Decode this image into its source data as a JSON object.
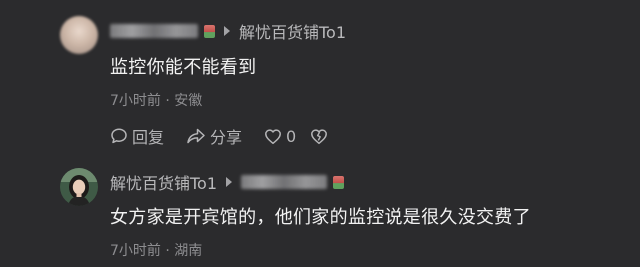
{
  "comments": [
    {
      "reply_to": "解忧百货铺To1",
      "text": "监控你能不能看到",
      "time": "7小时前",
      "location": "安徽",
      "actions": {
        "reply": "回复",
        "share": "分享",
        "likes": "0"
      }
    },
    {
      "author": "解忧百货铺To1",
      "text": "女方家是开宾馆的，他们家的监控说是很久没交费了",
      "time": "7小时前",
      "location": "湖南"
    }
  ],
  "separator": "·",
  "colors": {
    "background": "#2b2b2d",
    "primary_text": "#f2f2f2",
    "secondary_text": "#b9b9bb",
    "muted_text": "#8d8d90"
  },
  "icons": [
    "reply-icon",
    "share-icon",
    "heart-icon",
    "broken-heart-icon",
    "reply-arrow-icon",
    "badge-icon"
  ]
}
